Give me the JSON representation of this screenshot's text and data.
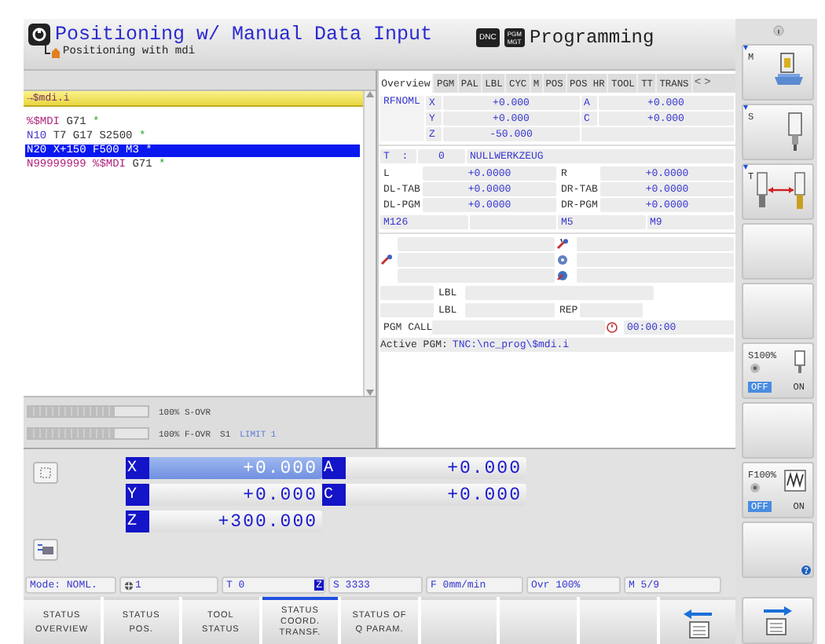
{
  "header": {
    "title": "Positioning w/ Manual Data Input",
    "subtitle": "Positioning with mdi",
    "dnc": "DNC",
    "pgm_mgt": [
      "PGM",
      "MGT"
    ],
    "programming": "Programming"
  },
  "program": {
    "file_arrow": "→",
    "file": "$mdi.i",
    "lines": [
      {
        "selected": false,
        "tokens": [
          {
            "text": "%$MDI",
            "kind": "label"
          },
          {
            "text": "G71",
            "kind": "code"
          },
          {
            "text": "*",
            "kind": "end"
          }
        ]
      },
      {
        "selected": false,
        "tokens": [
          {
            "text": "N10",
            "kind": "block"
          },
          {
            "text": "T7 G17 S2500",
            "kind": "code"
          },
          {
            "text": "*",
            "kind": "end"
          }
        ]
      },
      {
        "selected": true,
        "tokens": [
          {
            "text": "N20",
            "kind": "block"
          },
          {
            "text": "X+150 F500 M3",
            "kind": "code"
          },
          {
            "text": "*",
            "kind": "end"
          }
        ]
      },
      {
        "selected": false,
        "tokens": [
          {
            "text": "N99999999 %$MDI",
            "kind": "label"
          },
          {
            "text": "G71",
            "kind": "code"
          },
          {
            "text": "*",
            "kind": "end"
          }
        ]
      }
    ]
  },
  "overrides": [
    {
      "label": "100% S-OVR",
      "level": 0.72
    },
    {
      "label": "100% F-OVR",
      "spindle": "S1",
      "limit": "LIMIT 1",
      "level": 0.72
    }
  ],
  "status": {
    "tabs": [
      {
        "label": "Overview",
        "selected": true
      },
      {
        "label": "PGM",
        "selected": false
      },
      {
        "label": "PAL",
        "selected": false
      },
      {
        "label": "LBL",
        "selected": false
      },
      {
        "label": "CYC",
        "selected": false
      },
      {
        "label": "M",
        "selected": false
      },
      {
        "label": "POS",
        "selected": false
      },
      {
        "label": "POS HR",
        "selected": false
      },
      {
        "label": "TOOL",
        "selected": false
      },
      {
        "label": "TT",
        "selected": false
      },
      {
        "label": "TRANS",
        "selected": false
      }
    ],
    "prev": "<",
    "next": ">",
    "coords": {
      "label": "RFNOML",
      "axes": [
        {
          "axis": "X",
          "value": "+0.000"
        },
        {
          "axis": "Y",
          "value": "+0.000"
        },
        {
          "axis": "Z",
          "value": "-50.000"
        }
      ],
      "rot_axes": [
        {
          "axis": "A",
          "value": "+0.000"
        },
        {
          "axis": "C",
          "value": "+0.000"
        }
      ]
    },
    "tool": {
      "label": "T",
      "sep": ":",
      "number": "0",
      "name": "NULLWERKZEUG"
    },
    "tool_values": [
      [
        {
          "name": "L",
          "value": "+0.0000"
        },
        {
          "name": "R",
          "value": "+0.0000"
        }
      ],
      [
        {
          "name": "DL-TAB",
          "value": "+0.0000"
        },
        {
          "name": "DR-TAB",
          "value": "+0.0000"
        }
      ],
      [
        {
          "name": "DL-PGM",
          "value": "+0.0000"
        },
        {
          "name": "DR-PGM",
          "value": "+0.0000"
        }
      ]
    ],
    "m_functions": [
      "M126",
      "M5",
      "M9"
    ],
    "lbl_rows": [
      {
        "label": "LBL"
      },
      {
        "label": "LBL",
        "rep": "REP"
      }
    ],
    "pgm_call": {
      "label": "PGM CALL",
      "time": "00:00:00"
    },
    "active_pgm": {
      "label": "Active PGM:",
      "path": "TNC:\\nc_prog\\$mdi.i"
    }
  },
  "positions": {
    "main": [
      {
        "axis": "X",
        "value": "+0.000",
        "selected": true
      },
      {
        "axis": "Y",
        "value": "+0.000",
        "selected": false
      },
      {
        "axis": "Z",
        "value": "+300.000",
        "selected": false
      }
    ],
    "second": [
      {
        "axis": "A",
        "value": "+0.000"
      },
      {
        "axis": "C",
        "value": "+0.000"
      }
    ]
  },
  "status_line": {
    "mode": "Mode: NOML.",
    "datum": "1",
    "tool": "T 0",
    "tool_axis": "Z",
    "spindle": "S 3333",
    "feed": "F 0mm/min",
    "override": "Ovr 100%",
    "m": "M 5/9"
  },
  "softkeys": [
    {
      "kind": "text",
      "lines": [
        "STATUS",
        "OVERVIEW"
      ],
      "selected": false
    },
    {
      "kind": "text",
      "lines": [
        "STATUS",
        "POS."
      ],
      "selected": false
    },
    {
      "kind": "text",
      "lines": [
        "TOOL",
        "STATUS"
      ],
      "selected": false
    },
    {
      "kind": "text",
      "lines": [
        "STATUS",
        "COORD.",
        "TRANSF."
      ],
      "selected": true
    },
    {
      "kind": "text",
      "lines": [
        "STATUS OF",
        "Q PARAM."
      ],
      "selected": false
    },
    {
      "kind": "blank",
      "selected": false
    },
    {
      "kind": "blank",
      "selected": false
    },
    {
      "kind": "blank",
      "selected": false
    },
    {
      "kind": "back",
      "selected": false
    }
  ],
  "side_keys": [
    {
      "kind": "machine",
      "label": "M"
    },
    {
      "kind": "spindle",
      "label": "S"
    },
    {
      "kind": "tool-change",
      "label": "T"
    },
    {
      "kind": "blank"
    },
    {
      "kind": "blank"
    },
    {
      "kind": "spindle-override",
      "label": "S100%",
      "options": [
        {
          "label": "OFF",
          "selected": true
        },
        {
          "label": "ON",
          "selected": false
        }
      ]
    },
    {
      "kind": "blank"
    },
    {
      "kind": "feed-override",
      "label": "F100%",
      "options": [
        {
          "label": "OFF",
          "selected": true
        },
        {
          "label": "ON",
          "selected": false
        }
      ]
    },
    {
      "kind": "help"
    },
    {
      "kind": "forward"
    }
  ]
}
